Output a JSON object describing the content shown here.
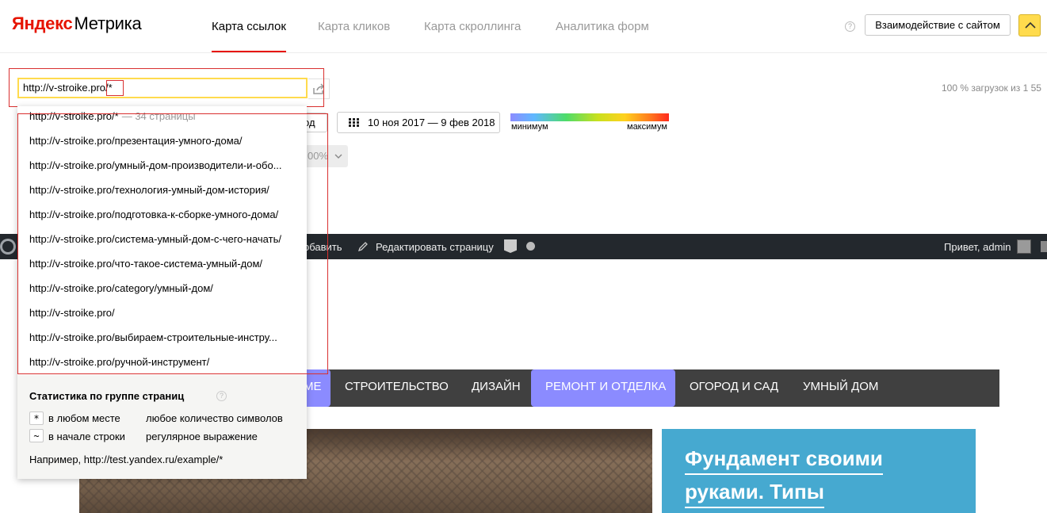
{
  "header": {
    "logo_brand": "Яндекс",
    "logo_product": "Метрика",
    "tabs": [
      {
        "label": "Карта ссылок",
        "active": true
      },
      {
        "label": "Карта кликов",
        "active": false
      },
      {
        "label": "Карта скроллинга",
        "active": false
      },
      {
        "label": "Аналитика форм",
        "active": false
      }
    ],
    "help_glyph": "?",
    "interact_button": "Взаимодействие с сайтом",
    "accent_color": "#e61400",
    "button_yellow": "#ffdb4d"
  },
  "url_bar": {
    "value": "http://v-stroike.pro/*",
    "load_stat": "100 % загрузок из 1 55"
  },
  "controls": {
    "period_button_fragment": "од",
    "date_range": "10 ноя 2017 — 9 фев 2018",
    "gradient_min": "минимум",
    "gradient_max": "максимум",
    "scroll_select_value": "00%"
  },
  "dropdown": {
    "items": [
      {
        "url": "http://v-stroike.pro/*",
        "count": "— 34 страницы"
      },
      {
        "url": "http://v-stroike.pro/презентация-умного-дома/"
      },
      {
        "url": "http://v-stroike.pro/умный-дом-производители-и-обо..."
      },
      {
        "url": "http://v-stroike.pro/технология-умный-дом-история/"
      },
      {
        "url": "http://v-stroike.pro/подготовка-к-сборке-умного-дома/"
      },
      {
        "url": "http://v-stroike.pro/система-умный-дом-с-чего-начать/"
      },
      {
        "url": "http://v-stroike.pro/что-такое-система-умный-дом/"
      },
      {
        "url": "http://v-stroike.pro/category/умный-дом/"
      },
      {
        "url": "http://v-stroike.pro/"
      },
      {
        "url": "http://v-stroike.pro/выбираем-строительные-инстру..."
      },
      {
        "url": "http://v-stroike.pro/ручной-инструмент/"
      }
    ],
    "stats_title": "Статистика по группе страниц",
    "legend": [
      {
        "key": "*",
        "label": "в любом месте",
        "desc": "любое количество символов"
      },
      {
        "key": "~",
        "label": "в начале строки",
        "desc": "регулярное выражение"
      }
    ],
    "example": "Например, http://test.yandex.ru/example/*"
  },
  "wp_bar": {
    "add_fragment": "обавить",
    "edit_page": "Редактировать страницу",
    "greeting": "Привет, admin"
  },
  "site": {
    "nav_fragment": "МЕ",
    "nav_items": [
      "СТРОИТЕЛЬСТВО",
      "ДИЗАЙН",
      "РЕМОНТ И ОТДЕЛКА",
      "ОГОРОД И САД",
      "УМНЫЙ ДОМ"
    ],
    "card_title_line1": "Фундамент своими",
    "card_title_line2": "руками. Типы",
    "nav_active_color": "#8b8bff",
    "card_color": "#46a9d0"
  }
}
